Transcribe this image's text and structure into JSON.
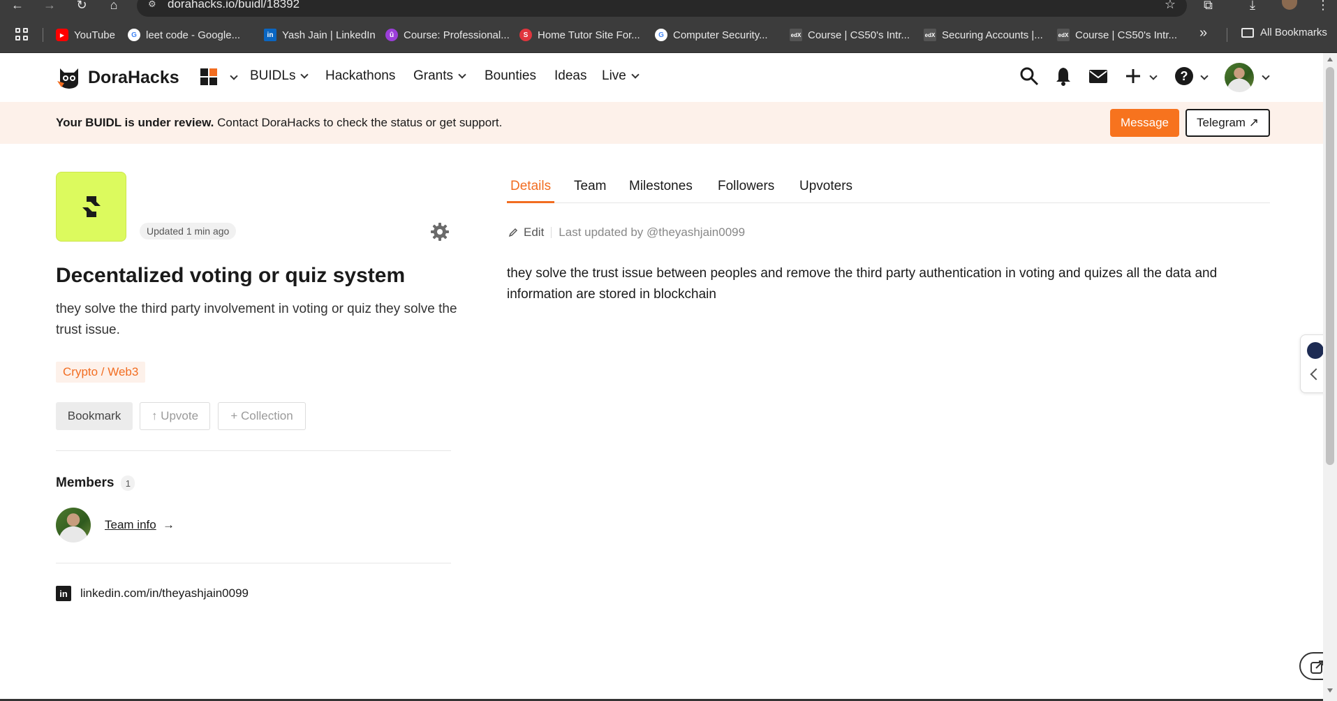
{
  "browser": {
    "url": "dorahacks.io/buidl/18392",
    "bookmarks": [
      {
        "label": "YouTube",
        "icon": "youtube-icon",
        "color": "#ff0000"
      },
      {
        "label": "leet code - Google...",
        "icon": "google-icon",
        "color": "#ffffff"
      },
      {
        "label": "Yash Jain | LinkedIn",
        "icon": "linkedin-icon",
        "color": "#0a66c2"
      },
      {
        "label": "Course: Professional...",
        "icon": "moodle-icon",
        "color": "#9b3ed9"
      },
      {
        "label": "Home Tutor Site For...",
        "icon": "tutor-site-icon",
        "color": "#e0353d"
      },
      {
        "label": "Computer Security...",
        "icon": "google-icon",
        "color": "#ffffff"
      },
      {
        "label": "Course | CS50's Intr...",
        "icon": "edx-icon",
        "color": "#555555"
      },
      {
        "label": "Securing Accounts |...",
        "icon": "edx-icon",
        "color": "#555555"
      },
      {
        "label": "Course | CS50's Intr...",
        "icon": "edx-icon",
        "color": "#555555"
      }
    ],
    "more": "»",
    "all_bookmarks": "All Bookmarks"
  },
  "header": {
    "brand": "DoraHacks",
    "nav": [
      {
        "label": "BUIDLs",
        "dropdown": true
      },
      {
        "label": "Hackathons",
        "dropdown": false
      },
      {
        "label": "Grants",
        "dropdown": true
      },
      {
        "label": "Bounties",
        "dropdown": false
      },
      {
        "label": "Ideas",
        "dropdown": false
      },
      {
        "label": "Live",
        "dropdown": true
      }
    ]
  },
  "banner": {
    "bold": "Your BUIDL is under review.",
    "text": " Contact DoraHacks to check the status or get support.",
    "message_label": "Message",
    "telegram_label": "Telegram ↗",
    "accent": "#f7731e"
  },
  "project": {
    "updated": "Updated 1 min ago",
    "title": "Decentalized voting or quiz system",
    "description": "they solve the third party involvement in voting or quiz they solve the trust issue.",
    "tag": "Crypto / Web3",
    "bookmark_label": "Bookmark",
    "upvote_label": "↑ Upvote",
    "collection_label": "+ Collection",
    "members_title": "Members",
    "members_count": "1",
    "team_info": "Team info",
    "team_arrow": "→",
    "linkedin": "linkedin.com/in/theyashjain0099"
  },
  "details": {
    "tabs": [
      "Details",
      "Team",
      "Milestones",
      "Followers",
      "Upvoters"
    ],
    "active_tab": "Details",
    "edit_label": "Edit",
    "last_updated": "Last updated by @theyashjain0099",
    "body": "they solve the trust issue between peoples and remove the third party authentication in voting and quizes all the data and information are stored in blockchain"
  }
}
